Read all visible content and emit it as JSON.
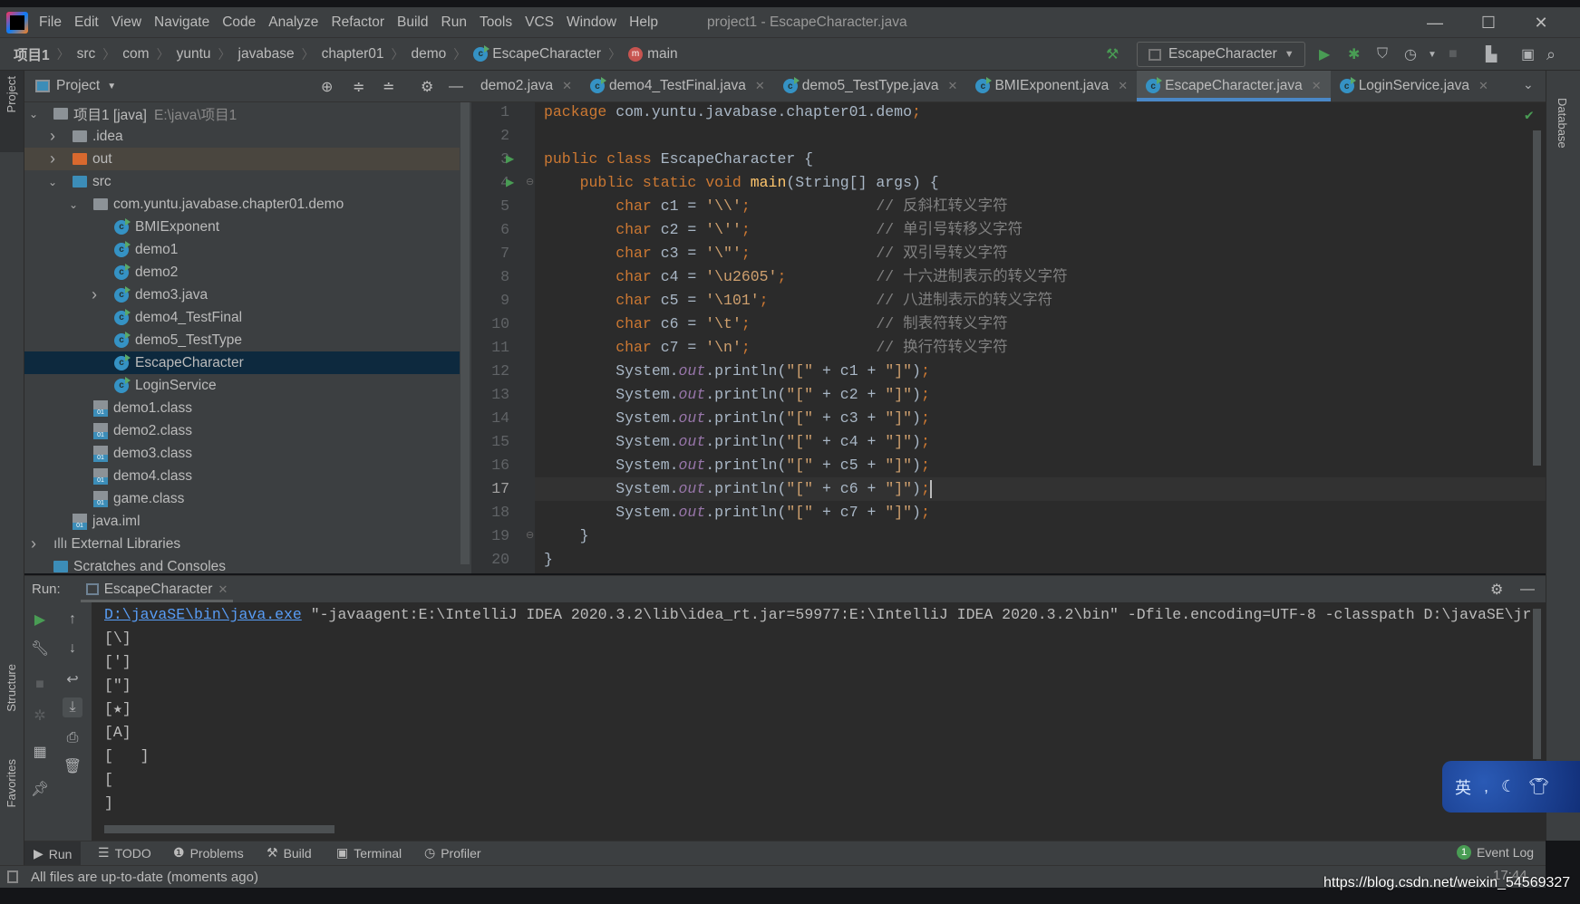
{
  "window": {
    "title": "project1 - EscapeCharacter.java",
    "menu": [
      "File",
      "Edit",
      "View",
      "Navigate",
      "Code",
      "Analyze",
      "Refactor",
      "Build",
      "Run",
      "Tools",
      "VCS",
      "Window",
      "Help"
    ],
    "controls": {
      "minimize": "—",
      "maximize": "☐",
      "close": "✕"
    }
  },
  "breadcrumb": [
    "项目1",
    "src",
    "com",
    "yuntu",
    "javabase",
    "chapter01",
    "demo",
    "EscapeCharacter",
    "main"
  ],
  "toolbar": {
    "run_config": "EscapeCharacter"
  },
  "project": {
    "header": "Project",
    "tree": [
      {
        "label": "项目1 [java]",
        "hint": "E:\\java\\项目1",
        "level": 0,
        "arrow": "down",
        "icon": "module"
      },
      {
        "label": ".idea",
        "level": 1,
        "arrow": "right",
        "icon": "folder"
      },
      {
        "label": "out",
        "level": 1,
        "arrow": "right",
        "icon": "folder-orange",
        "excluded": true
      },
      {
        "label": "src",
        "level": 1,
        "arrow": "down",
        "icon": "folder-blue"
      },
      {
        "label": "com.yuntu.javabase.chapter01.demo",
        "level": 2,
        "arrow": "down",
        "icon": "package"
      },
      {
        "label": "BMIExponent",
        "level": 3,
        "icon": "class"
      },
      {
        "label": "demo1",
        "level": 3,
        "icon": "class"
      },
      {
        "label": "demo2",
        "level": 3,
        "icon": "class"
      },
      {
        "label": "demo3.java",
        "level": 3,
        "arrow": "right",
        "icon": "class"
      },
      {
        "label": "demo4_TestFinal",
        "level": 3,
        "icon": "class"
      },
      {
        "label": "demo5_TestType",
        "level": 3,
        "icon": "class"
      },
      {
        "label": "EscapeCharacter",
        "level": 3,
        "icon": "class",
        "selected": true
      },
      {
        "label": "LoginService",
        "level": 3,
        "icon": "class"
      },
      {
        "label": "demo1.class",
        "level": 2,
        "icon": "classfile"
      },
      {
        "label": "demo2.class",
        "level": 2,
        "icon": "classfile"
      },
      {
        "label": "demo3.class",
        "level": 2,
        "icon": "classfile"
      },
      {
        "label": "demo4.class",
        "level": 2,
        "icon": "classfile"
      },
      {
        "label": "game.class",
        "level": 2,
        "icon": "classfile"
      },
      {
        "label": "java.iml",
        "level": 1,
        "icon": "iml"
      },
      {
        "label": "External Libraries",
        "level": 0,
        "arrow": "right",
        "icon": "libraries"
      },
      {
        "label": "Scratches and Consoles",
        "level": 0,
        "icon": "scratches"
      }
    ]
  },
  "editor": {
    "tabs": [
      {
        "label": "demo2.java",
        "icon": false
      },
      {
        "label": "demo4_TestFinal.java",
        "icon": true
      },
      {
        "label": "demo5_TestType.java",
        "icon": true
      },
      {
        "label": "BMIExponent.java",
        "icon": true
      },
      {
        "label": "EscapeCharacter.java",
        "icon": true,
        "active": true
      },
      {
        "label": "LoginService.java",
        "icon": true
      }
    ],
    "current_line": 17,
    "lines": [
      [
        [
          "k",
          "package"
        ],
        [
          "p",
          " com.yuntu.javabase.chapter01.demo"
        ],
        [
          "k",
          ";"
        ]
      ],
      [],
      [
        [
          "k",
          "public class"
        ],
        [
          "p",
          " EscapeCharacter {"
        ]
      ],
      [
        [
          "p",
          "    "
        ],
        [
          "k",
          "public static void"
        ],
        [
          "p",
          " "
        ],
        [
          "m",
          "main"
        ],
        [
          "p",
          "(String[] args) {"
        ]
      ],
      [
        [
          "p",
          "        "
        ],
        [
          "k",
          "char"
        ],
        [
          "p",
          " c1 = "
        ],
        [
          "s",
          "'\\\\'"
        ],
        [
          "k",
          ";"
        ],
        [
          "p",
          "              "
        ],
        [
          "c",
          "// 反斜杠转义字符"
        ]
      ],
      [
        [
          "p",
          "        "
        ],
        [
          "k",
          "char"
        ],
        [
          "p",
          " c2 = "
        ],
        [
          "s",
          "'\\''"
        ],
        [
          "k",
          ";"
        ],
        [
          "p",
          "              "
        ],
        [
          "c",
          "// 单引号转移义字符"
        ]
      ],
      [
        [
          "p",
          "        "
        ],
        [
          "k",
          "char"
        ],
        [
          "p",
          " c3 = "
        ],
        [
          "s",
          "'\\\"'"
        ],
        [
          "k",
          ";"
        ],
        [
          "p",
          "              "
        ],
        [
          "c",
          "// 双引号转义字符"
        ]
      ],
      [
        [
          "p",
          "        "
        ],
        [
          "k",
          "char"
        ],
        [
          "p",
          " c4 = "
        ],
        [
          "s",
          "'\\u2605'"
        ],
        [
          "k",
          ";"
        ],
        [
          "p",
          "          "
        ],
        [
          "c",
          "// 十六进制表示的转义字符"
        ]
      ],
      [
        [
          "p",
          "        "
        ],
        [
          "k",
          "char"
        ],
        [
          "p",
          " c5 = "
        ],
        [
          "s",
          "'\\101'"
        ],
        [
          "k",
          ";"
        ],
        [
          "p",
          "            "
        ],
        [
          "c",
          "// 八进制表示的转义字符"
        ]
      ],
      [
        [
          "p",
          "        "
        ],
        [
          "k",
          "char"
        ],
        [
          "p",
          " c6 = "
        ],
        [
          "s",
          "'\\t'"
        ],
        [
          "k",
          ";"
        ],
        [
          "p",
          "              "
        ],
        [
          "c",
          "// 制表符转义字符"
        ]
      ],
      [
        [
          "p",
          "        "
        ],
        [
          "k",
          "char"
        ],
        [
          "p",
          " c7 = "
        ],
        [
          "s",
          "'\\n'"
        ],
        [
          "k",
          ";"
        ],
        [
          "p",
          "              "
        ],
        [
          "c",
          "// 换行符转义字符"
        ]
      ],
      [
        [
          "p",
          "        System."
        ],
        [
          "f",
          "out"
        ],
        [
          "p",
          ".println("
        ],
        [
          "s",
          "\"[\""
        ],
        [
          "p",
          " + c1 + "
        ],
        [
          "s",
          "\"]\""
        ],
        [
          "p",
          ")"
        ],
        [
          "k",
          ";"
        ]
      ],
      [
        [
          "p",
          "        System."
        ],
        [
          "f",
          "out"
        ],
        [
          "p",
          ".println("
        ],
        [
          "s",
          "\"[\""
        ],
        [
          "p",
          " + c2 + "
        ],
        [
          "s",
          "\"]\""
        ],
        [
          "p",
          ")"
        ],
        [
          "k",
          ";"
        ]
      ],
      [
        [
          "p",
          "        System."
        ],
        [
          "f",
          "out"
        ],
        [
          "p",
          ".println("
        ],
        [
          "s",
          "\"[\""
        ],
        [
          "p",
          " + c3 + "
        ],
        [
          "s",
          "\"]\""
        ],
        [
          "p",
          ")"
        ],
        [
          "k",
          ";"
        ]
      ],
      [
        [
          "p",
          "        System."
        ],
        [
          "f",
          "out"
        ],
        [
          "p",
          ".println("
        ],
        [
          "s",
          "\"[\""
        ],
        [
          "p",
          " + c4 + "
        ],
        [
          "s",
          "\"]\""
        ],
        [
          "p",
          ")"
        ],
        [
          "k",
          ";"
        ]
      ],
      [
        [
          "p",
          "        System."
        ],
        [
          "f",
          "out"
        ],
        [
          "p",
          ".println("
        ],
        [
          "s",
          "\"[\""
        ],
        [
          "p",
          " + c5 + "
        ],
        [
          "s",
          "\"]\""
        ],
        [
          "p",
          ")"
        ],
        [
          "k",
          ";"
        ]
      ],
      [
        [
          "p",
          "        System."
        ],
        [
          "f",
          "out"
        ],
        [
          "p",
          ".println("
        ],
        [
          "s",
          "\"[\""
        ],
        [
          "p",
          " + c6 + "
        ],
        [
          "s",
          "\"]\""
        ],
        [
          "p",
          ")"
        ],
        [
          "k",
          ";"
        ]
      ],
      [
        [
          "p",
          "        System."
        ],
        [
          "f",
          "out"
        ],
        [
          "p",
          ".println("
        ],
        [
          "s",
          "\"[\""
        ],
        [
          "p",
          " + c7 + "
        ],
        [
          "s",
          "\"]\""
        ],
        [
          "p",
          ")"
        ],
        [
          "k",
          ";"
        ]
      ],
      [
        [
          "p",
          "    }"
        ]
      ],
      [
        [
          "p",
          "}"
        ]
      ]
    ]
  },
  "run": {
    "label": "Run:",
    "tab": "EscapeCharacter",
    "command_link": "D:\\javaSE\\bin\\java.exe",
    "command_rest": " \"-javaagent:E:\\IntelliJ IDEA 2020.3.2\\lib\\idea_rt.jar=59977:E:\\IntelliJ IDEA 2020.3.2\\bin\" -Dfile.encoding=UTF-8 -classpath D:\\javaSE\\jr",
    "output": [
      "[\\]",
      "[']",
      "[\"]",
      "[★]",
      "[A]",
      "[\t]",
      "[",
      "]"
    ]
  },
  "bottom_tabs": [
    "Run",
    "TODO",
    "Problems",
    "Build",
    "Terminal",
    "Profiler"
  ],
  "event_log": {
    "label": "Event Log",
    "count": "1"
  },
  "side_labels": {
    "project": "Project",
    "structure": "Structure",
    "favorites": "Favorites",
    "database": "Database"
  },
  "status": {
    "message": "All files are up-to-date (moments ago)",
    "time": "17:44"
  },
  "ime": {
    "mode": "英"
  },
  "watermark": "https://blog.csdn.net/weixin_54569327",
  "colors": {
    "keyword": "#CC7832",
    "string": "#CFA06E",
    "comment": "#808080",
    "accent": "#4A88C7",
    "run_green": "#499C54"
  }
}
